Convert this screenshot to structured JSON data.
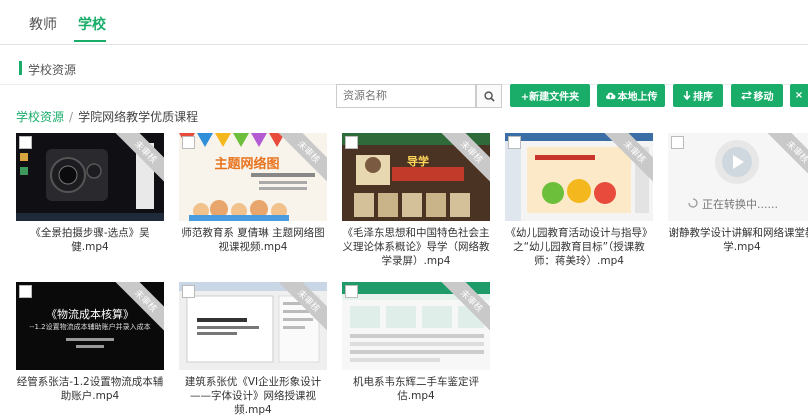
{
  "tabs": [
    {
      "label": "教师",
      "active": false
    },
    {
      "label": "学校",
      "active": true
    }
  ],
  "section": {
    "title": "学校资源"
  },
  "search": {
    "placeholder": "资源名称"
  },
  "toolbar": {
    "new_folder": "+新建文件夹",
    "upload": "本地上传",
    "sort": "排序",
    "move": "移动",
    "more": "×"
  },
  "breadcrumb": {
    "root": "学校资源",
    "current": "学院网络教学优质课程"
  },
  "badge": "未审核",
  "files": [
    {
      "caption": "《全景拍摄步骤-选点》吴健.mp4"
    },
    {
      "caption": "师范教育系 夏倩琳 主题网络图视课视频.mp4",
      "thumb_text": "主题网络图"
    },
    {
      "caption": "《毛泽东思想和中国特色社会主义理论体系概论》导学（网络教学录屏）.mp4",
      "thumb_text": "导学"
    },
    {
      "caption": "《幼儿园教育活动设计与指导》之“幼儿园教育目标”（授课教师：蒋美玲）.mp4"
    },
    {
      "caption": "谢静教学设计讲解和网络课堂教学.mp4",
      "thumb_text": "正在转换中......"
    },
    {
      "caption": "经管系张洁-1.2设置物流成本辅助账户.mp4",
      "thumb_text": "《物流成本核算》",
      "thumb_sub": "--1.2设置物流成本辅助账户并录入成本"
    },
    {
      "caption": "建筑系张优《VI企业形象设计——字体设计》网络授课视频.mp4"
    },
    {
      "caption": "机电系韦东辉二手车鉴定评估.mp4"
    }
  ],
  "colors": {
    "accent": "#1aad6a",
    "badge": "#c9c9c9"
  }
}
